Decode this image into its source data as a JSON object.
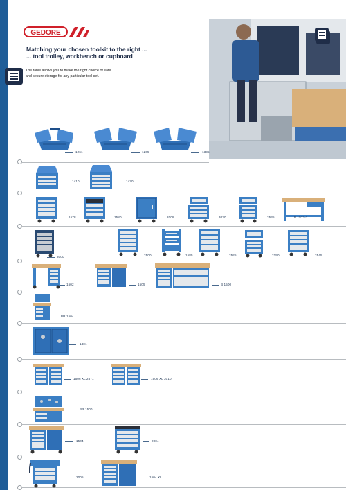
{
  "brand": "GEDORE",
  "headline_line1": "Matching your chosen toolkit to the right ...",
  "headline_line2": "... tool trolley, workbench or cupboard",
  "intro_line1": "The table allows you to make the right choice of safe",
  "intro_line2": "and secure storage for any particular tool set.",
  "colors": {
    "brand_blue": "#1f5d98",
    "product_blue": "#3b7fc4",
    "wood": "#d9b07a",
    "brand_red": "#d0202a"
  },
  "icons": [
    "tool-cabinet-icon",
    "tool-cabinet-icon",
    "row-marker-dot"
  ],
  "products": {
    "p1261": "1261",
    "p1265": "1265",
    "p1335": "1335",
    "p1410": "1410",
    "p1420": "1420",
    "p1578": "1578",
    "p1580": "1580",
    "p2008": "2008",
    "p3030": "3030",
    "p2535": "2535",
    "pB1573": "B 1573-2",
    "p3000": "3000",
    "p2500": "2500",
    "p1585": "1585",
    "p2525": "2525",
    "p2150": "2150",
    "p2545": "2545",
    "p1502": "1502",
    "p1505": "1505",
    "pB1500": "B 1500",
    "pBR1504": "BR 1504",
    "p1401": "1401",
    "p15062571": "1506 XL 2571",
    "p15063010": "1506 XL 3010",
    "pBR1500": "BR 1500",
    "p1504": "1504",
    "p2004": "2004",
    "p2005": "2005",
    "p1504XL": "1504 XL"
  }
}
